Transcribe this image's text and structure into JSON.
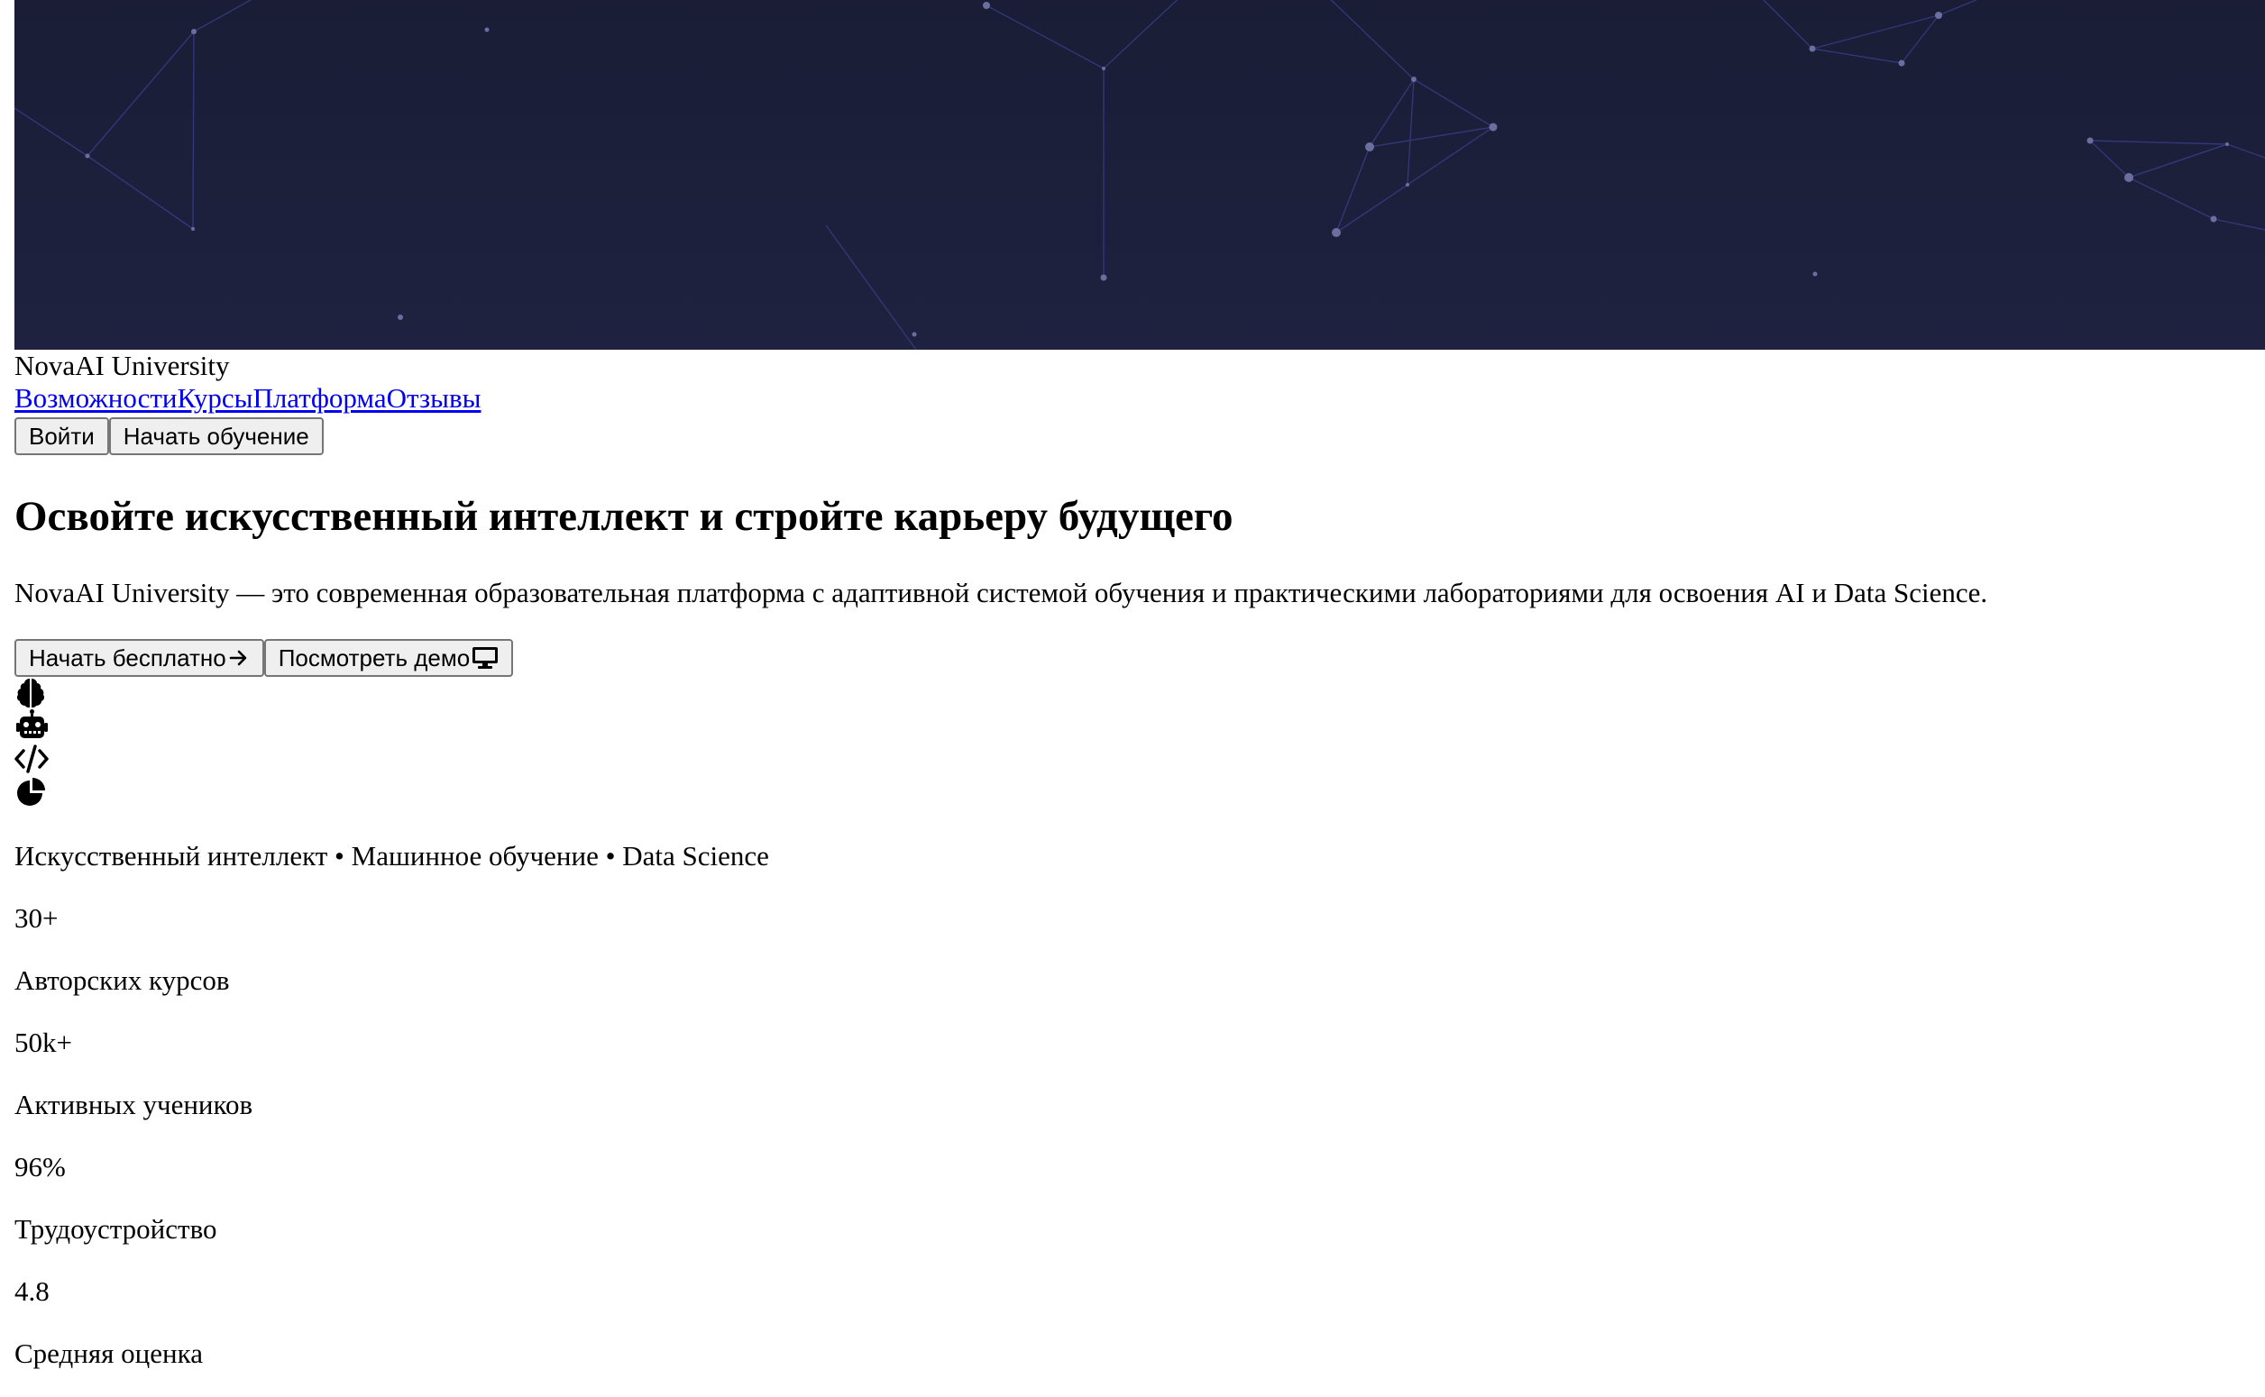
{
  "brand": {
    "name": "NovaAI University"
  },
  "nav": {
    "items": [
      {
        "label": "Возможности"
      },
      {
        "label": "Курсы"
      },
      {
        "label": "Платформа"
      },
      {
        "label": "Отзывы"
      }
    ]
  },
  "header": {
    "login_label": "Войти",
    "start_label": "Начать обучение"
  },
  "hero": {
    "title": "Освойте искусственный интеллект и стройте карьеру будущего",
    "lead": "NovaAI University — это современная образовательная платформа с адаптивной системой обучения и практическими лабораториями для освоения AI и Data Science.",
    "cta_primary": "Начать бесплатно",
    "cta_secondary": "Посмотреть демо",
    "icons": [
      "brain-icon",
      "robot-icon",
      "code-icon",
      "pie-chart-icon"
    ],
    "tags": "Искусственный интеллект • Машинное обучение • Data Science"
  },
  "stats": [
    {
      "value": "30+",
      "label": "Авторских курсов"
    },
    {
      "value": "50k+",
      "label": "Активных учеников"
    },
    {
      "value": "96%",
      "label": "Трудоустройство"
    },
    {
      "value": "4.8",
      "label": "Средняя оценка"
    }
  ],
  "colors": {
    "hero_bg": "#1c1f3a",
    "network_line": "#3b3f8f",
    "network_node": "#6a6f9e",
    "link": "#0000ee"
  }
}
